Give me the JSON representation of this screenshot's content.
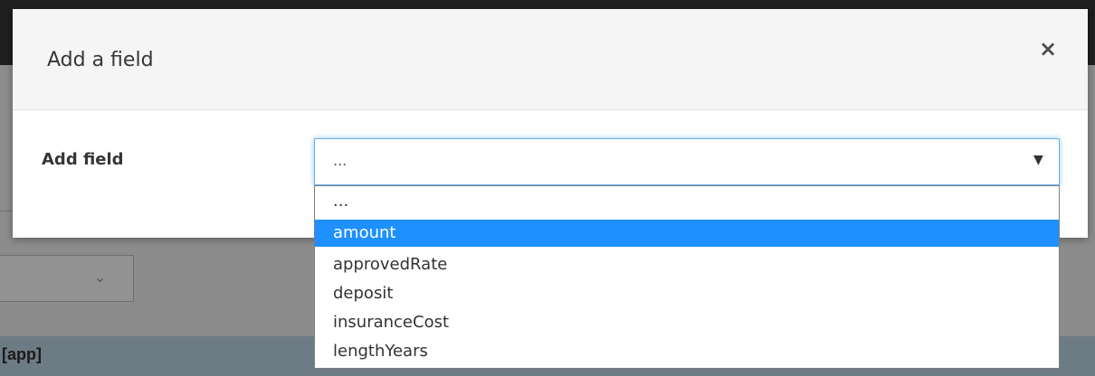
{
  "background": {
    "app_label": "[app]"
  },
  "modal": {
    "title": "Add a field",
    "close_label": "×",
    "field_label": "Add field",
    "select": {
      "value": "...",
      "caret": "▼"
    },
    "options": [
      {
        "label": "...",
        "selected": false
      },
      {
        "label": "amount",
        "selected": true
      },
      {
        "label": "approvedRate",
        "selected": false
      },
      {
        "label": "deposit",
        "selected": false
      },
      {
        "label": "insuranceCost",
        "selected": false
      },
      {
        "label": "lengthYears",
        "selected": false
      }
    ]
  },
  "colors": {
    "highlight": "#1e90ff",
    "focus_border": "#66afe9"
  },
  "icons": {
    "close": "close-icon",
    "select_caret": "caret-down-icon",
    "bg_chevron": "chevron-down-icon"
  }
}
